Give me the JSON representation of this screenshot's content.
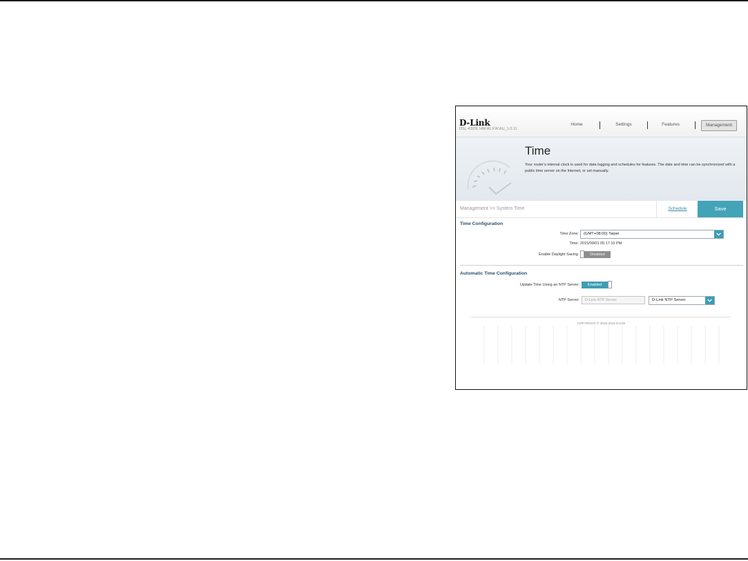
{
  "header": {
    "brand": "D-Link",
    "model_info": "DSL-4320L   HW:A1   FW:AU_1.0.11",
    "nav": [
      "Home",
      "Settings",
      "Features",
      "Management"
    ],
    "active_nav": "Management"
  },
  "hero": {
    "title": "Time",
    "description": "Your router's internal clock is used for data logging and schedules for features. The date and time can be synchronized with a public time server on the Internet, or set manually."
  },
  "breadcrumb": "Management >> System Time",
  "actions": {
    "schedule": "Schedule",
    "save": "Save"
  },
  "time_config": {
    "title": "Time Configuration",
    "time_zone_label": "Time Zone:",
    "time_zone_value": "(GMT+08:00) Taipei",
    "time_label": "Time:",
    "time_value": "2015/09/01 05:17:10 PM",
    "dst_label": "Enable Daylight Saving",
    "dst_state": "Disabled"
  },
  "auto_time": {
    "title": "Automatic Time Configuration",
    "ntp_update_label": "Update Time Using an NTP Server:",
    "ntp_update_state": "Enabled",
    "ntp_server_label": "NTP Server:",
    "ntp_server_placeholder": "D-Link NTP Server",
    "ntp_server_select": "D-Link NTP Server"
  },
  "footer": {
    "copyright": "COPYRIGHT © 2015-2016 D-Link"
  },
  "colors": {
    "accent": "#43a3b8",
    "disabled_toggle": "#8e8e8e",
    "section_title": "#2c4e6b"
  }
}
